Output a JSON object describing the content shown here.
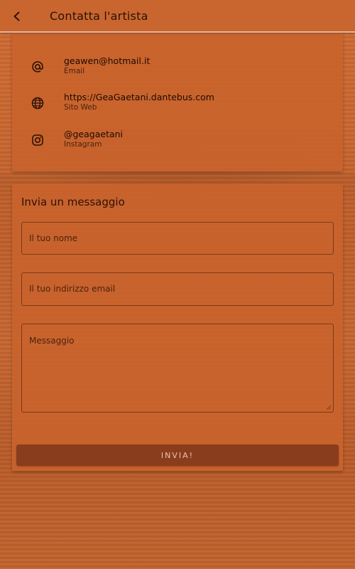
{
  "appbar": {
    "title": "Contatta l'artista",
    "back_icon": "back-arrow-icon"
  },
  "contacts": [
    {
      "icon": "at-sign-icon",
      "value": "geawen@hotmail.it",
      "label": "Email"
    },
    {
      "icon": "globe-icon",
      "value": "https://GeaGaetani.dantebus.com",
      "label": "Sito Web"
    },
    {
      "icon": "instagram-icon",
      "value": "@geagaetani",
      "label": "Instagram"
    }
  ],
  "message_form": {
    "title": "Invia un messaggio",
    "name_placeholder": "Il tuo nome",
    "email_placeholder": "Il tuo indirizzo email",
    "message_placeholder": "Messaggio",
    "send_label": "INVIA!"
  },
  "colors": {
    "accent": "#c9662f",
    "button": "#8a3d1c",
    "text": "#2a1206"
  }
}
